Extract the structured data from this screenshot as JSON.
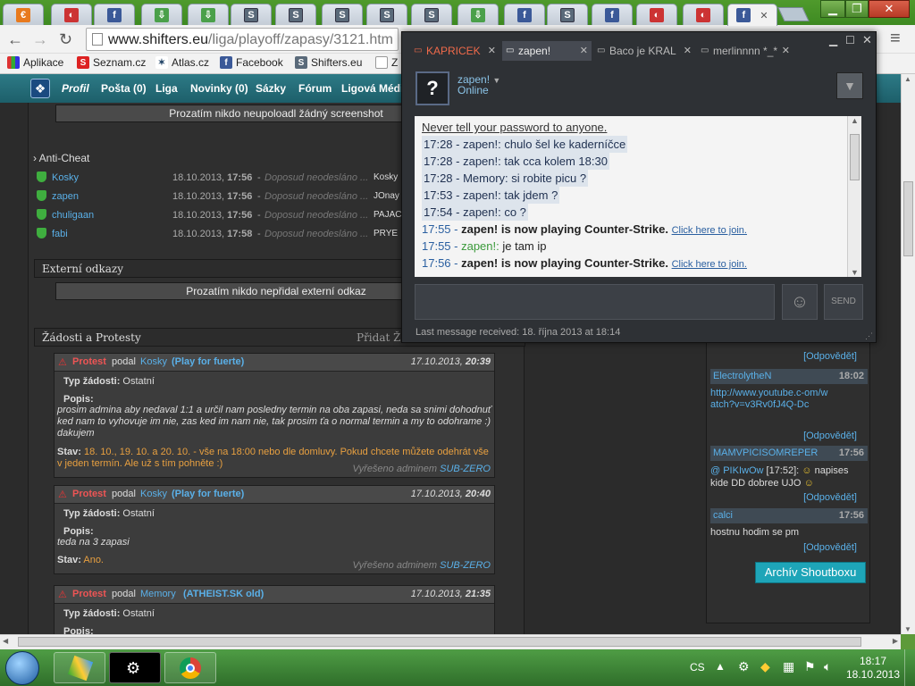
{
  "browser": {
    "tab_icons": [
      "fav-o",
      "fav-n",
      "fav-f",
      "fav-d",
      "fav-d",
      "fav-s",
      "fav-s",
      "fav-s",
      "fav-s",
      "fav-s",
      "fav-d",
      "fav-f",
      "fav-s",
      "fav-f",
      "fav-n",
      "fav-n",
      "fav-f",
      "fav-s"
    ],
    "url_host": "www.shifters.eu",
    "url_path": "/liga/playoff/zapasy/3121.htm",
    "bookmarks": [
      "Aplikace",
      "Seznam.cz",
      "Atlas.cz",
      "Facebook",
      "Shifters.eu",
      "Z"
    ]
  },
  "site": {
    "nav": [
      "Profil",
      "Pošta (0)",
      "Liga",
      "Novinky (0)",
      "Sázky",
      "Fórum",
      "Ligová Média"
    ],
    "no_screenshot": "Prozatím nikdo neupoloadl žádný screenshot",
    "anticheat_title": "Anti-Cheat",
    "anticheat": [
      {
        "name": "Kosky",
        "date": "18.10.2013, ",
        "time": "17:56",
        "status": "Doposud neodesláno ...",
        "user": "Kosky"
      },
      {
        "name": "zapen",
        "date": "18.10.2013, ",
        "time": "17:56",
        "status": "Doposud neodesláno ...",
        "user": "JOnay"
      },
      {
        "name": "chuligaan",
        "date": "18.10.2013, ",
        "time": "17:56",
        "status": "Doposud neodesláno ...",
        "user": "PAJAC"
      },
      {
        "name": "fabi",
        "date": "18.10.2013, ",
        "time": "17:58",
        "status": "Doposud neodesláno ...",
        "user": "PRYE"
      }
    ],
    "external_title": "Externí odkazy",
    "no_external": "Prozatím nikdo nepřidal externí odkaz",
    "requests_title": "Žádosti a Protesty",
    "requests_add": "Přidat Ž",
    "protests": [
      {
        "kind": "Protest",
        "by": "podal",
        "user": "Kosky",
        "team": "(Play for fuerte)",
        "date": "17.10.2013, ",
        "time": "20:39",
        "type_label": "Typ žádosti:",
        "type": "Ostatní",
        "desc_label": "Popis:",
        "desc": "prosim admina aby nedaval 1:1 a určil nam posledny termin na oba zapasi, neda sa snimi dohodnuť ked nam to vyhovuje im nie, zas ked im nam nie, tak prosim ťa o normal termin a my to odohrame :) dakujem",
        "state_label": "Stav:",
        "state": "18. 10., 19. 10. a 20. 10. - vše na 18:00 nebo dle domluvy. Pokud chcete můžete odehrát vše v jeden termín. Ale už s tím pohněte :)",
        "resolved": "Vyřešeno adminem",
        "admin": "SUB-ZERO"
      },
      {
        "kind": "Protest",
        "by": "podal",
        "user": "Kosky",
        "team": "(Play for fuerte)",
        "date": "17.10.2013, ",
        "time": "20:40",
        "type_label": "Typ žádosti:",
        "type": "Ostatní",
        "desc_label": "Popis:",
        "desc": "teda na 3 zapasi",
        "state_label": "Stav:",
        "state": "Ano.",
        "resolved": "Vyřešeno adminem",
        "admin": "SUB-ZERO"
      },
      {
        "kind": "Protest",
        "by": "podal",
        "user": "Memory",
        "team": "(ATHEIST.SK old)",
        "date": "17.10.2013, ",
        "time": "21:35",
        "type_label": "Typ žádosti:",
        "type": "Ostatní",
        "desc_label": "Popis:"
      }
    ],
    "shoutbox": {
      "reply": "[Odpovědět]",
      "entries": [
        {
          "user": "ElectrolytheN",
          "time": "18:02",
          "text": "http://www.youtube.c-om/watch?v=v3Rv0fJ4Q-Dc"
        },
        {
          "user": "MAMVPICISOMREPER",
          "time": "17:56",
          "mention": "@ PIKIwOw",
          "mtime": "[17:52]:",
          "text": "napises kide DD dobree UJO"
        },
        {
          "user": "calci",
          "time": "17:56",
          "text": "hostnu hodim se pm"
        }
      ],
      "archive": "Archív Shoutboxu"
    }
  },
  "chat": {
    "tabs": [
      {
        "label": "KAPRICEK",
        "state": "alert"
      },
      {
        "label": "zapen!",
        "state": "active"
      },
      {
        "label": "Baco je KRAL",
        "state": "normal"
      },
      {
        "label": "merlinnnn *_*",
        "state": "normal"
      }
    ],
    "friend_name": "zapen!",
    "friend_status": "Online",
    "warning": "Never tell your password to anyone.",
    "messages": [
      {
        "text": "17:28 - zapen!: chulo šel ke kaderníčce",
        "hl": true
      },
      {
        "text": "17:28 - zapen!: tak cca kolem 18:30",
        "hl": true
      },
      {
        "text": "17:28 - Memory: si robite picu ?",
        "hl": true
      },
      {
        "text": "17:53 - zapen!: tak jdem ?",
        "hl": true
      },
      {
        "text": "17:54 - zapen!: co ?",
        "hl": true
      }
    ],
    "game_msgs": [
      {
        "time": "17:55 - ",
        "who": "zapen! is now playing Counter-Strike.",
        "join": "Click here to join."
      },
      {
        "time": "17:55 - ",
        "who2": "zapen!:",
        "text": " je tam ip"
      },
      {
        "time": "17:56 - ",
        "who": "zapen! is now playing Counter-Strike.",
        "join": "Click here to join."
      }
    ],
    "send_label": "SEND",
    "last_received": "Last message received: 18. října 2013 at 18:14"
  },
  "taskbar": {
    "lang": "CS",
    "time": "18:17",
    "date": "18.10.2013"
  }
}
